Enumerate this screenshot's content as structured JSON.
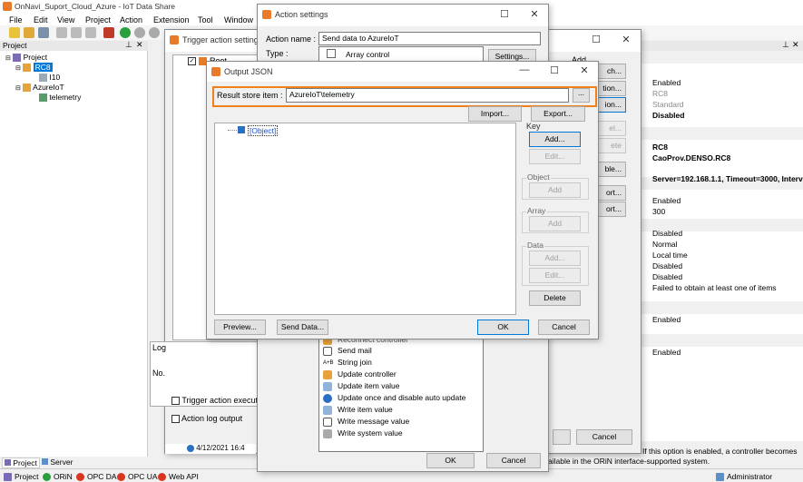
{
  "app": {
    "title": "OnNavi_Suport_Cloud_Azure - IoT Data Share"
  },
  "menu": [
    "File",
    "Edit",
    "View",
    "Project",
    "Action",
    "Extension",
    "Tool",
    "Window"
  ],
  "project_panel": {
    "title": "Project",
    "tree": {
      "root": "Project",
      "rc8": "RC8",
      "i10": "I10",
      "azure": "AzureIoT",
      "telemetry": "telemetry"
    },
    "tabs": {
      "project": "Project",
      "server": "Server"
    }
  },
  "trigger_dialog": {
    "title": "Trigger action settings",
    "root": "Root",
    "log_label": "Log",
    "no_label": "No.",
    "timestamp": "4/12/2021 16:4",
    "chk_trigger_exec": "Trigger action executi",
    "chk_action_log": "Action log output"
  },
  "action_dialog": {
    "title": "Action settings",
    "action_name_label": "Action name :",
    "action_name_value": "Send data to AzureIoT",
    "type_label": "Type :",
    "type_value": "Array control",
    "settings_button": "Settings...",
    "add_label": "Add",
    "right_buttons": [
      "ch...",
      "tion...",
      "ion...",
      "el...",
      "ete",
      "ble...",
      "ort...",
      "ort..."
    ],
    "list_items": [
      "Reconnect controller",
      "Send mail",
      "String join",
      "Update controller",
      "Update item value",
      "Update once and disable auto update",
      "Write item value",
      "Write message value",
      "Write system value"
    ],
    "ok": "OK",
    "cancel": "Cancel",
    "back_cancel": "Cancel"
  },
  "output_json": {
    "title": "Output JSON",
    "result_label": "Result store item :",
    "result_value": "AzureIoT\\telemetry",
    "browse": "...",
    "import": "Import...",
    "export": "Export...",
    "tree_object": "[Object]",
    "key_group": "Key",
    "key_add": "Add...",
    "key_edit": "Edit...",
    "object_group": "Object",
    "object_add": "Add",
    "array_group": "Array",
    "array_add": "Add",
    "data_group": "Data",
    "data_add": "Add...",
    "data_edit": "Edit...",
    "delete": "Delete",
    "preview": "Preview...",
    "send_data": "Send Data...",
    "ok": "OK",
    "cancel": "Cancel"
  },
  "properties": {
    "enabled1": "Enabled",
    "rc8": "RC8",
    "standard": "Standard",
    "disabled1": "Disabled",
    "rc8b": "RC8",
    "caoprov": "CaoProv.DENSO.RC8",
    "server": "Server=192.168.1.1, Timeout=3000, Interv",
    "enabled2": "Enabled",
    "n300": "300",
    "disabled2": "Disabled",
    "normal": "Normal",
    "localtime": "Local time",
    "disabled3": "Disabled",
    "disabled4": "Disabled",
    "failed": "Failed to obtain at least one of items",
    "enabled3": "Enabled",
    "enabled4": "Enabled",
    "help_line1": "ables/Disables a controller. If this option is enabled, a controller becomes",
    "help_line2": "ailable in the ORiN interface-supported system."
  },
  "status_bar": {
    "project": "Project",
    "orin": "ORiN",
    "opcda": "OPC DA",
    "opcua": "OPC UA",
    "webapi": "Web API",
    "user": "Administrator"
  },
  "colors": {
    "accent": "#0078d7",
    "highlight": "#f0801a",
    "ok_green": "#2a9d3c",
    "stop_red": "#d9351f"
  }
}
